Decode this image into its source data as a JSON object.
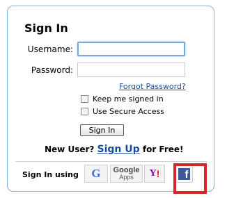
{
  "form": {
    "title": "Sign In",
    "username_label": "Username:",
    "username_value": "",
    "password_label": "Password:",
    "password_value": "",
    "forgot_link": "Forgot Password?",
    "keep_signed_in_label": "Keep me signed in",
    "secure_access_label": "Use Secure Access",
    "signin_button": "Sign In"
  },
  "signup": {
    "prefix": "New User? ",
    "link": "Sign Up",
    "suffix": " for Free!"
  },
  "providers": {
    "label": "Sign In using",
    "google_icon_text": "G",
    "google_apps_line1": "Google",
    "google_apps_line2": "Apps",
    "yahoo_text": "Y",
    "yahoo_exclaim": "!",
    "facebook_text": "f"
  },
  "icons": {
    "google": "google-icon",
    "google_apps": "google-apps-icon",
    "yahoo": "yahoo-icon",
    "facebook": "facebook-icon"
  },
  "colors": {
    "panel_border": "#7fb3d9",
    "link": "#1a4d9b",
    "facebook": "#3b5998",
    "highlight": "#d7262a"
  }
}
